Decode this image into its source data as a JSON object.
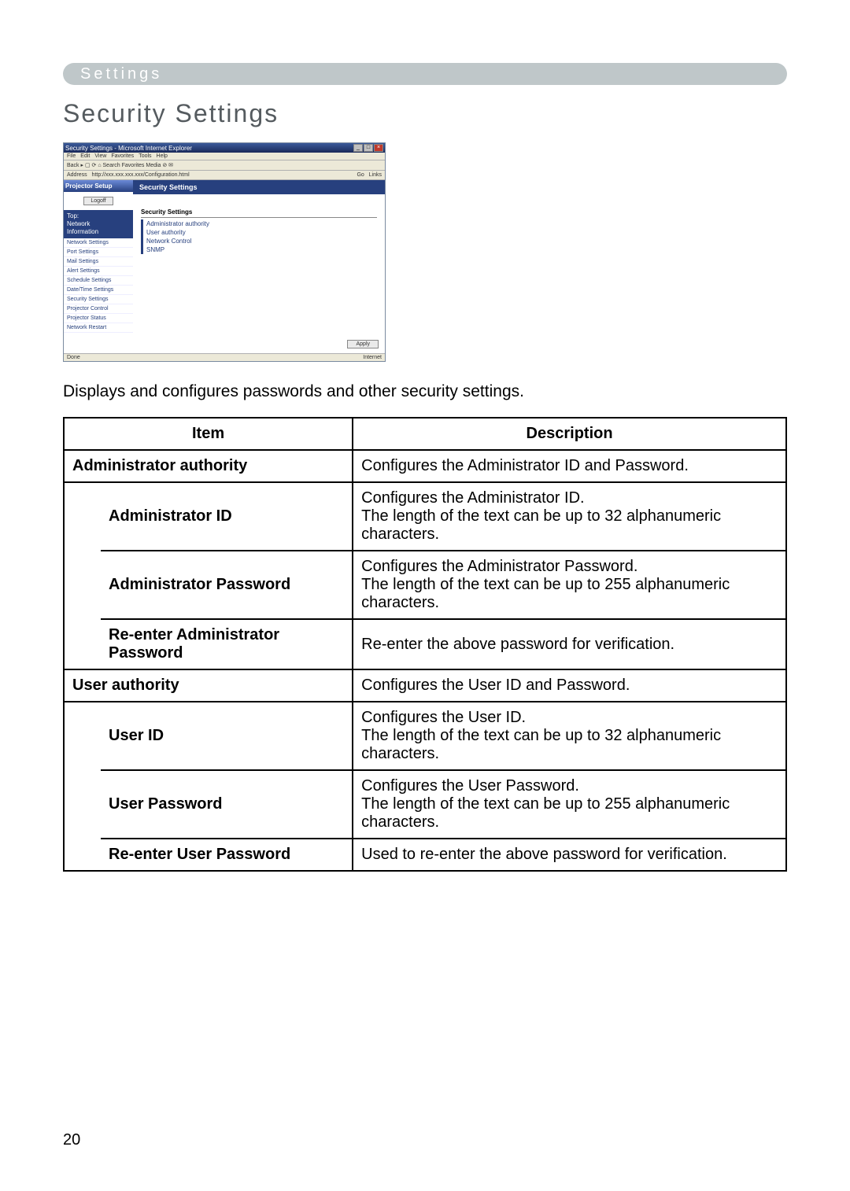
{
  "settings_bar": "Settings",
  "heading": "Security Settings",
  "intro": "Displays and configures passwords and other security settings.",
  "page_number": "20",
  "table": {
    "head_item": "Item",
    "head_desc": "Description",
    "rows": {
      "admin_auth_item": "Administrator authority",
      "admin_auth_desc": "Configures the Administrator ID and Password.",
      "admin_id_item": "Administrator ID",
      "admin_id_desc": "Configures the Administrator ID.\nThe length of the text can be up to 32 alphanumeric characters.",
      "admin_pw_item": "Administrator Password",
      "admin_pw_desc": "Configures the Administrator Password.\nThe length of the text can be up to 255 alphanumeric characters.",
      "admin_repw_item": "Re-enter Administrator Password",
      "admin_repw_desc": "Re-enter the above password for verification.",
      "user_auth_item": "User authority",
      "user_auth_desc": "Configures the User ID and Password.",
      "user_id_item": "User ID",
      "user_id_desc": "Configures the User ID.\nThe length of the text can be up to 32 alphanumeric characters.",
      "user_pw_item": "User Password",
      "user_pw_desc": "Configures the User Password.\nThe length of the text can be up to 255 alphanumeric characters.",
      "user_repw_item": "Re-enter User Password",
      "user_repw_desc": "Used to re-enter the above password for verification."
    }
  },
  "screenshot": {
    "window_title": "Security Settings - Microsoft Internet Explorer",
    "menus": [
      "File",
      "Edit",
      "View",
      "Favorites",
      "Tools",
      "Help"
    ],
    "toolbar": "Back  ▸  ▢  ⟳  ⌂  Search  Favorites  Media  ⊘  ✉",
    "address_label": "Address",
    "address_value": "http://xxx.xxx.xxx.xxx/Configuration.html",
    "go_label": "Go",
    "links_label": "Links",
    "brand": "Projector Setup",
    "logoff": "Logoff",
    "sidebar_heading_line1": "Top:",
    "sidebar_heading_line2": "Network",
    "sidebar_heading_line3": "Information",
    "sidebar_items": [
      "Network Settings",
      "Port Settings",
      "Mail Settings",
      "Alert Settings",
      "Schedule Settings",
      "Date/Time Settings",
      "Security Settings",
      "Projector Control",
      "Projector Status",
      "Network Restart"
    ],
    "main_title": "Security Settings",
    "table_title": "Security Settings",
    "table_rows": [
      "Administrator authority",
      "User authority",
      "Network Control",
      "SNMP"
    ],
    "apply": "Apply",
    "status_left": "Done",
    "status_right": "Internet"
  }
}
